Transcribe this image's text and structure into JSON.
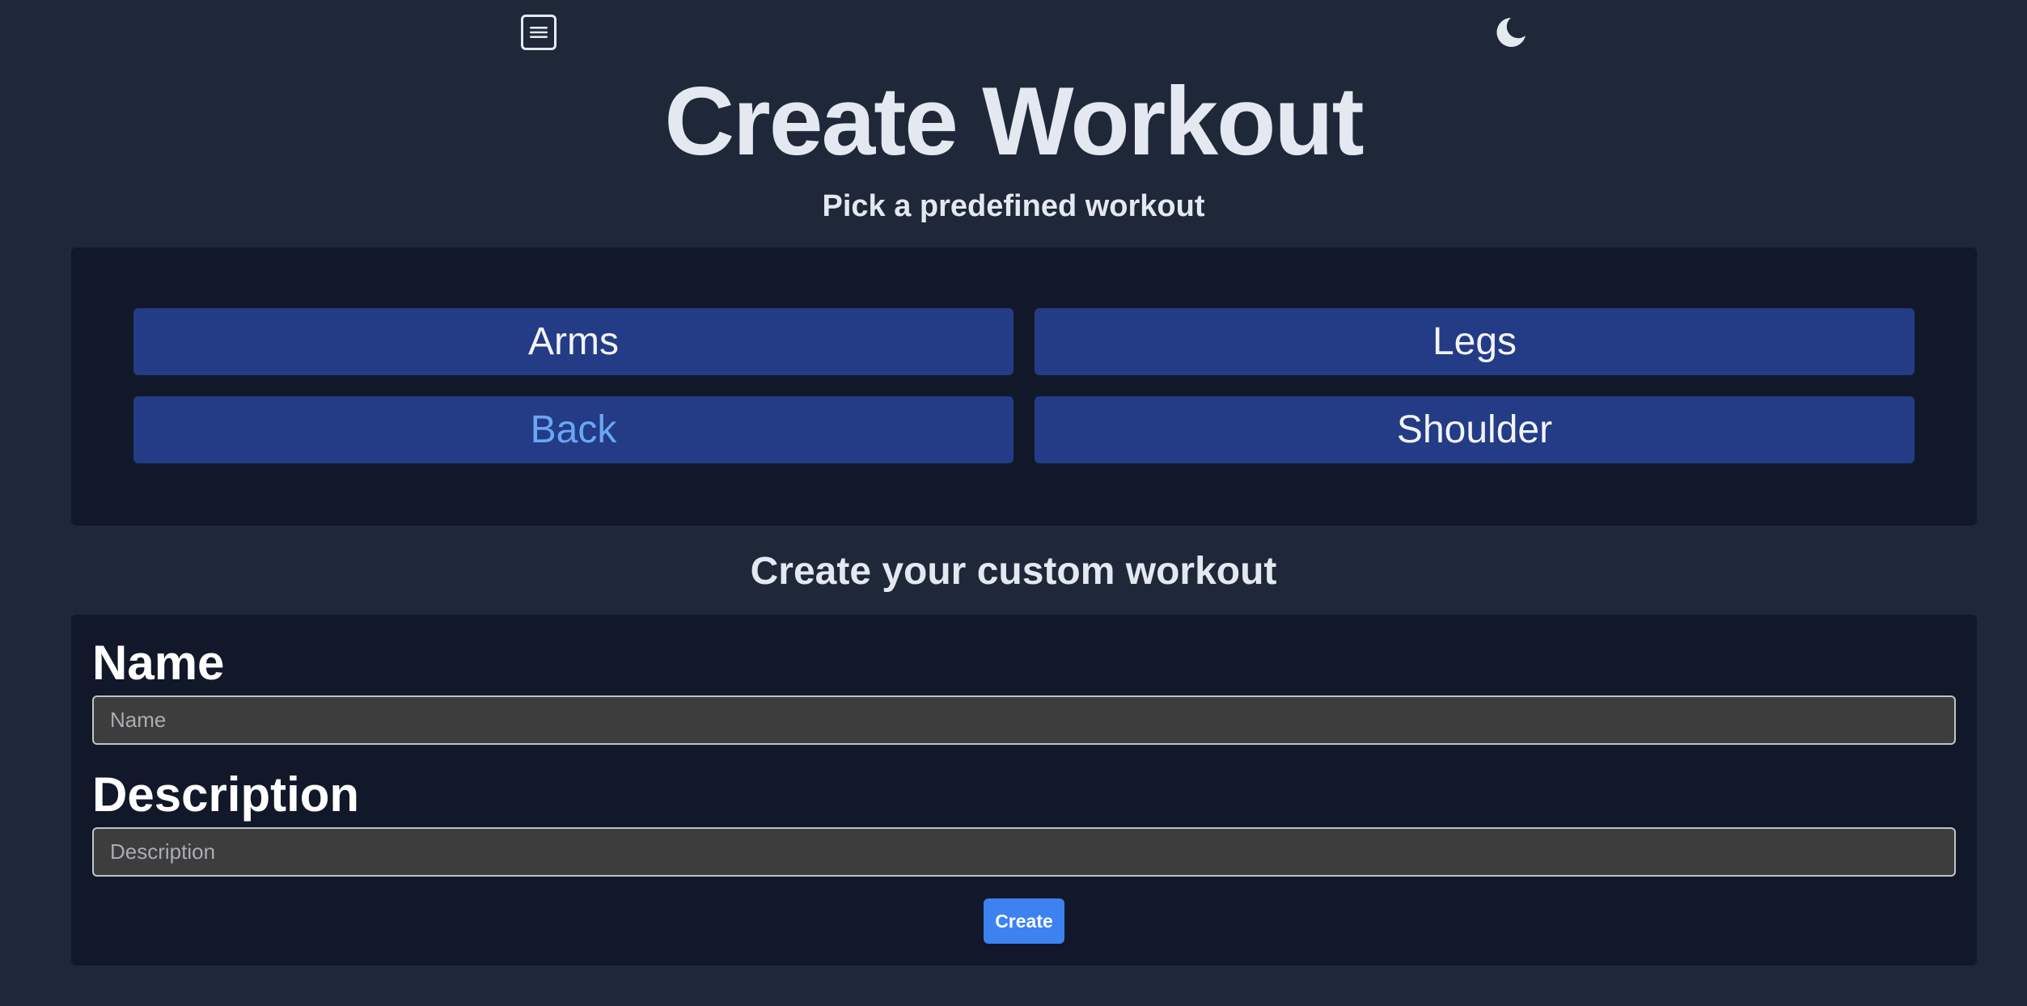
{
  "header": {
    "menu_icon": "hamburger-menu-icon",
    "theme_icon": "moon-icon",
    "title": "Create Workout"
  },
  "predefined": {
    "subtitle": "Pick a predefined workout",
    "workouts": [
      {
        "label": "Arms"
      },
      {
        "label": "Legs"
      },
      {
        "label": "Back"
      },
      {
        "label": "Shoulder"
      }
    ]
  },
  "custom": {
    "title": "Create your custom workout",
    "name_label": "Name",
    "name_placeholder": "Name",
    "description_label": "Description",
    "description_placeholder": "Description",
    "create_label": "Create"
  },
  "colors": {
    "page_bg": "#1f2839",
    "panel_bg": "#111829",
    "workout_button_bg": "#243b85",
    "hover_text": "#6aa6f5",
    "create_button_bg": "#3c82f0"
  }
}
